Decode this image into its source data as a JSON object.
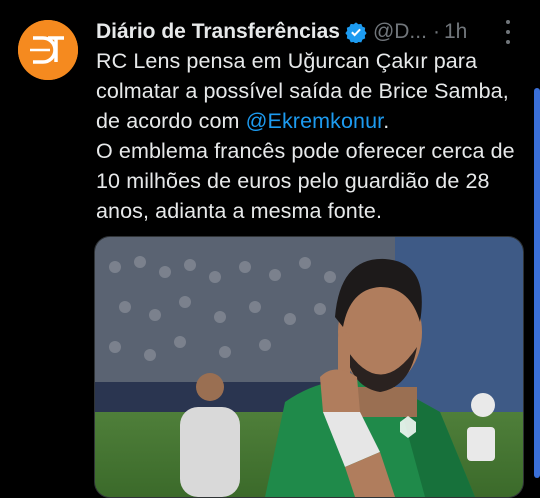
{
  "tweet": {
    "author_name": "Diário de Transferências",
    "handle": "@D...",
    "separator": "·",
    "time": "1h",
    "avatar_icon": "dt-logo-icon",
    "avatar_color": "#f58a1f",
    "verified_color": "#1d9bf0",
    "text_part1": "RC Lens pensa em Uğurcan Çakır para colmatar a possível saída de Brice Samba, de acordo com ",
    "mention": "@Ekremkonur",
    "text_part2": ".\nO emblema francês pode oferecer cerca de 10 milhões de euros pelo guardião de 28 anos, adianta a mesma fonte.",
    "media": {
      "icon": "goalkeeper-photo",
      "kit_color": "#1f8a4a"
    }
  }
}
